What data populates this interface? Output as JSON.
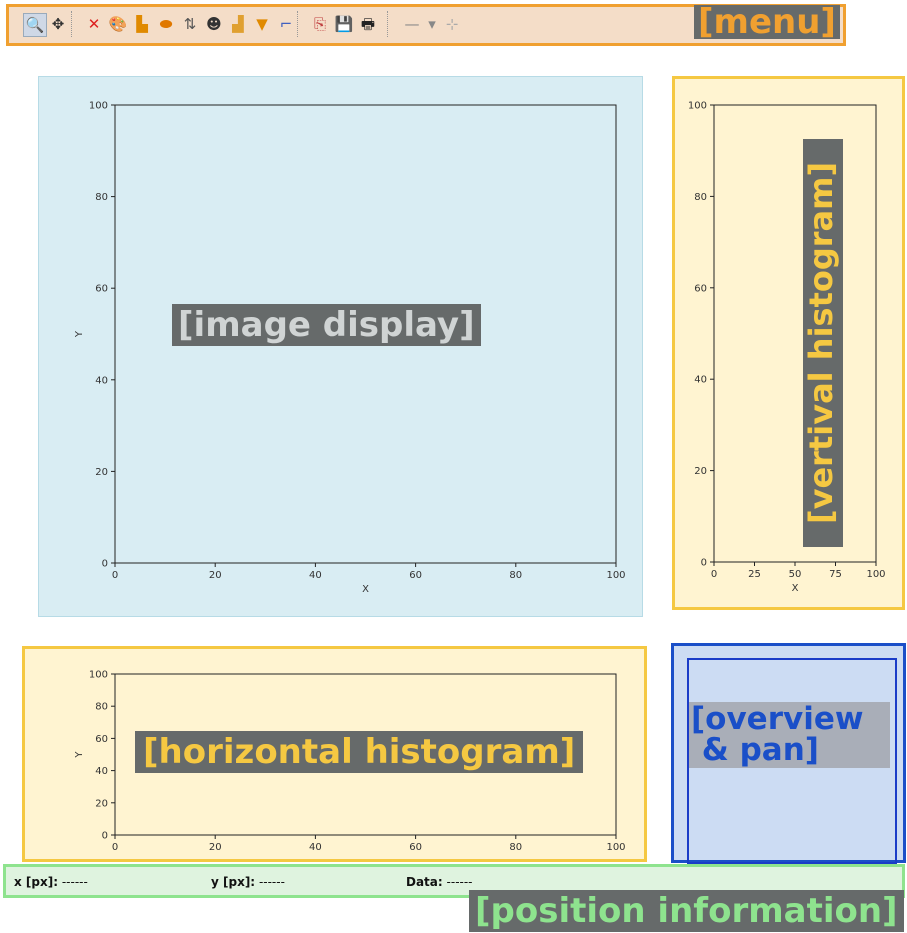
{
  "menu": {
    "label": "[menu]",
    "tools": [
      {
        "icon": "zoom-icon",
        "glyph": "🔍"
      },
      {
        "icon": "pan-icon",
        "glyph": "✥"
      },
      {
        "icon": "reset-zoom-icon",
        "glyph": "✕"
      },
      {
        "icon": "colormap-icon",
        "glyph": "🎨"
      },
      {
        "icon": "histogram-icon",
        "glyph": "▙"
      },
      {
        "icon": "mask-icon",
        "glyph": "⬬"
      },
      {
        "icon": "flip-y-icon",
        "glyph": "⇅"
      },
      {
        "icon": "mask-face-icon",
        "glyph": "☻"
      },
      {
        "icon": "axes-icon",
        "glyph": "▟"
      },
      {
        "icon": "filter-icon",
        "glyph": "▼"
      },
      {
        "icon": "axes-xy-icon",
        "glyph": "⌐"
      },
      {
        "icon": "copy-icon",
        "glyph": "⎘"
      },
      {
        "icon": "save-icon",
        "glyph": "💾"
      },
      {
        "icon": "print-icon",
        "glyph": "🖶"
      },
      {
        "icon": "line-style-icon",
        "glyph": "—"
      },
      {
        "icon": "dropdown-icon",
        "glyph": "▾"
      },
      {
        "icon": "marker-icon",
        "glyph": "⊹"
      }
    ]
  },
  "image_display": {
    "label": "[image display]",
    "xlabel": "X",
    "ylabel": "Y",
    "xticks": [
      "0",
      "20",
      "40",
      "60",
      "80",
      "100"
    ],
    "yticks": [
      "0",
      "20",
      "40",
      "60",
      "80",
      "100"
    ]
  },
  "vertical_histogram": {
    "label": "[vertival histogram]",
    "xlabel": "X",
    "xticks": [
      "0",
      "25",
      "50",
      "75",
      "100"
    ],
    "yticks": [
      "0",
      "20",
      "40",
      "60",
      "80",
      "100"
    ]
  },
  "horizontal_histogram": {
    "label": "[horizontal histogram]",
    "ylabel": "Y",
    "xticks": [
      "0",
      "20",
      "40",
      "60",
      "80",
      "100"
    ],
    "yticks": [
      "0",
      "20",
      "40",
      "60",
      "80",
      "100"
    ]
  },
  "overview": {
    "label_line1": "[overview",
    "label_line2": " & pan]"
  },
  "position": {
    "label": "[position information]",
    "x_label": "x [px]:",
    "x_value": "------",
    "y_label": "y [px]:",
    "y_value": "------",
    "data_label": "Data:",
    "data_value": "------"
  },
  "colors": {
    "menu": "#f0a030",
    "image_panel": "#d9edf3",
    "histogram_border": "#f5c842",
    "overview_border": "#1a4fc8",
    "position_border": "#8ee38e"
  },
  "chart_data": [
    {
      "type": "heatmap",
      "title": "",
      "xlabel": "X",
      "ylabel": "Y",
      "xlim": [
        0,
        100
      ],
      "ylim": [
        0,
        100
      ]
    },
    {
      "type": "bar",
      "title": "",
      "xlabel": "X",
      "ylabel": "",
      "xlim": [
        0,
        100
      ],
      "ylim": [
        0,
        100
      ]
    },
    {
      "type": "bar",
      "title": "",
      "xlabel": "",
      "ylabel": "Y",
      "xlim": [
        0,
        100
      ],
      "ylim": [
        0,
        100
      ]
    }
  ]
}
